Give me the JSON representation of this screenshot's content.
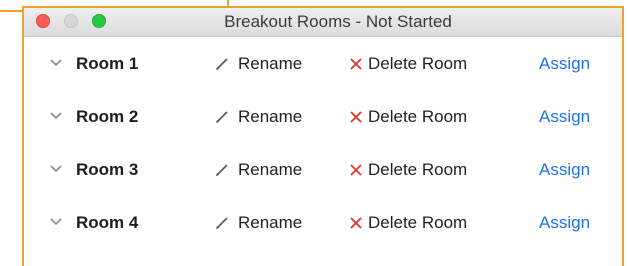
{
  "window": {
    "title": "Breakout Rooms - Not Started"
  },
  "rooms": [
    {
      "name": "Room 1",
      "rename_label": "Rename",
      "delete_label": "Delete Room",
      "assign_label": "Assign"
    },
    {
      "name": "Room 2",
      "rename_label": "Rename",
      "delete_label": "Delete Room",
      "assign_label": "Assign"
    },
    {
      "name": "Room 3",
      "rename_label": "Rename",
      "delete_label": "Delete Room",
      "assign_label": "Assign"
    },
    {
      "name": "Room 4",
      "rename_label": "Rename",
      "delete_label": "Delete Room",
      "assign_label": "Assign"
    }
  ],
  "colors": {
    "accent_border": "#f0a22e",
    "link": "#1a73e8",
    "delete_x": "#e8302a",
    "close_button": "#fc5f57",
    "maximize_button": "#2ac840"
  },
  "icons": {
    "expand": "chevron-down-icon",
    "rename": "pencil-icon",
    "delete": "x-icon"
  }
}
